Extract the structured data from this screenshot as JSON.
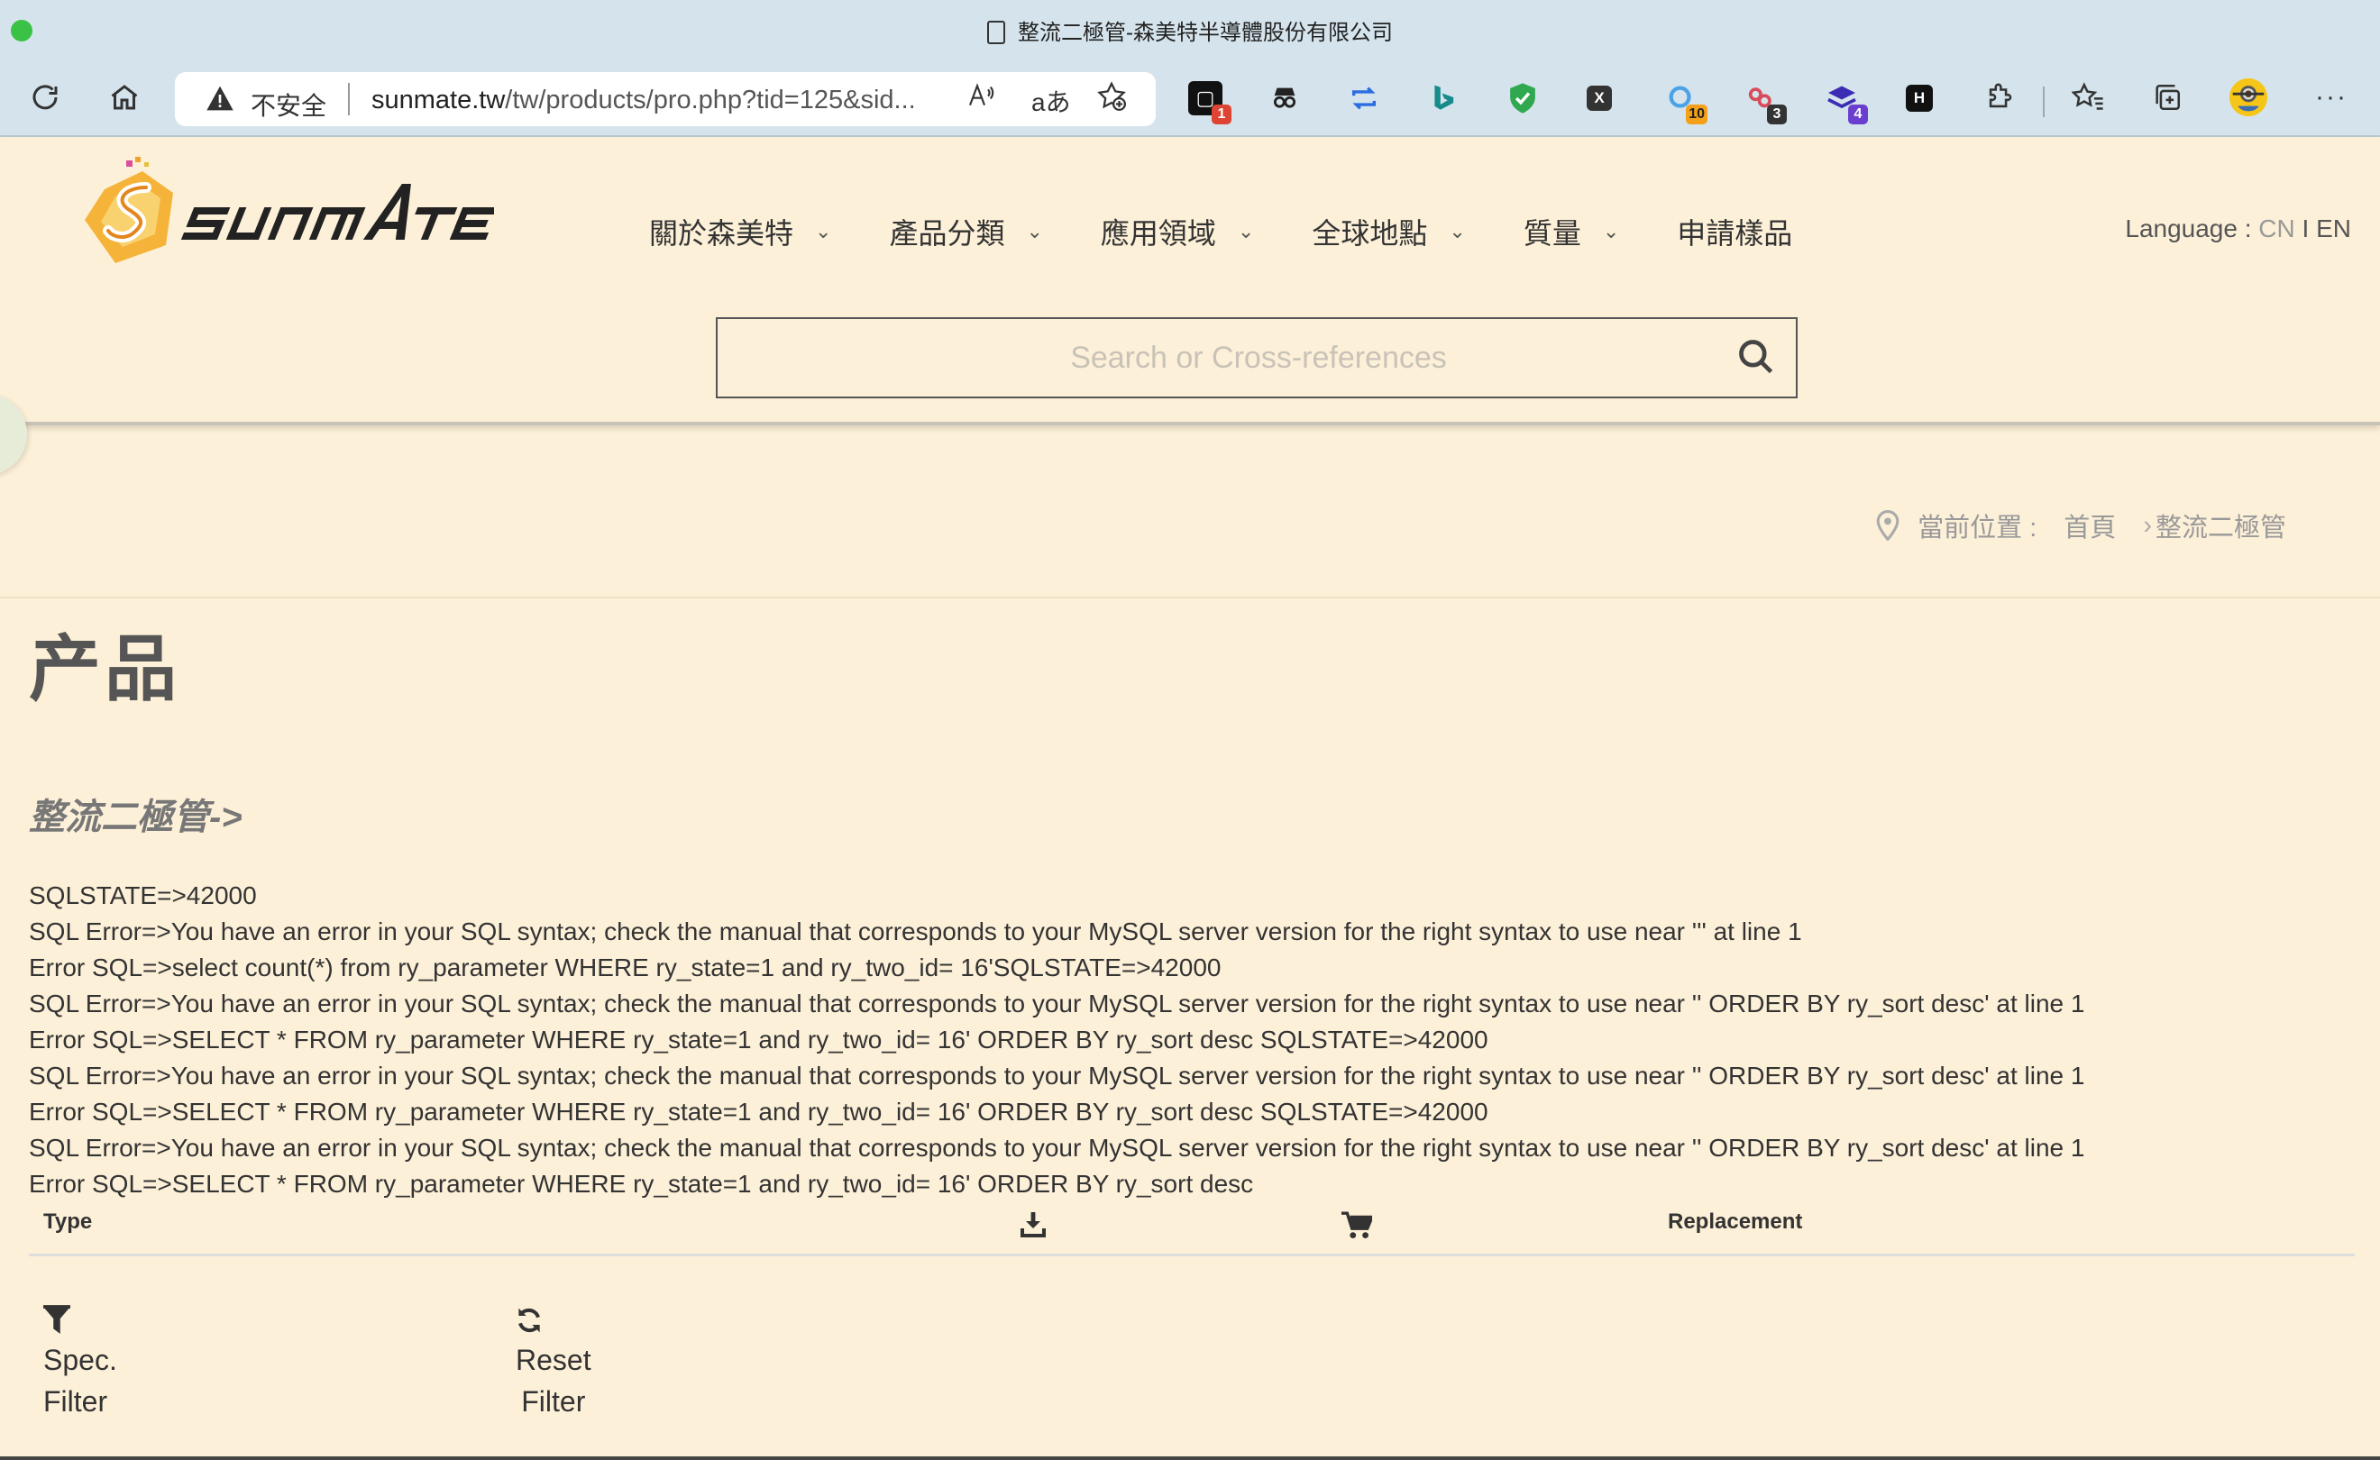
{
  "browser": {
    "tab_title": "整流二極管-森美特半導體股份有限公司",
    "security_label": "不安全",
    "url_host": "sunmate.tw",
    "url_path": "/tw/products/pro.php?tid=125&sid...",
    "extension_badges": {
      "ext1": "1",
      "ext7": "10",
      "ext8": "3",
      "ext9": "4"
    },
    "ext_letters": {
      "x": "X",
      "h": "H"
    }
  },
  "site": {
    "nav": [
      {
        "label": "關於森美特",
        "has_dropdown": true
      },
      {
        "label": "產品分類",
        "has_dropdown": true
      },
      {
        "label": "應用領域",
        "has_dropdown": true
      },
      {
        "label": "全球地點",
        "has_dropdown": true
      },
      {
        "label": "質量",
        "has_dropdown": true
      },
      {
        "label": "申請樣品",
        "has_dropdown": false
      }
    ],
    "language_label": "Language :",
    "lang_cn": "CN",
    "lang_sep": "I",
    "lang_en": "EN",
    "search_placeholder": "Search or Cross-references"
  },
  "breadcrumb": {
    "prefix": "當前位置 :",
    "home": "首頁",
    "current": "整流二極管"
  },
  "content": {
    "page_title": "产品",
    "category": "整流二極管->",
    "error_lines": [
      "SQLSTATE=>42000",
      "SQL Error=>You have an error in your SQL syntax; check the manual that corresponds to your MySQL server version for the right syntax to use near ''' at line 1",
      "Error SQL=>select count(*) from ry_parameter WHERE ry_state=1 and ry_two_id= 16'SQLSTATE=>42000",
      "SQL Error=>You have an error in your SQL syntax; check the manual that corresponds to your MySQL server version for the right syntax to use near '' ORDER BY ry_sort desc' at line 1",
      "Error SQL=>SELECT * FROM ry_parameter WHERE ry_state=1 and ry_two_id= 16' ORDER BY ry_sort desc SQLSTATE=>42000",
      "SQL Error=>You have an error in your SQL syntax; check the manual that corresponds to your MySQL server version for the right syntax to use near '' ORDER BY ry_sort desc' at line 1",
      "Error SQL=>SELECT * FROM ry_parameter WHERE ry_state=1 and ry_two_id= 16' ORDER BY ry_sort desc SQLSTATE=>42000",
      "SQL Error=>You have an error in your SQL syntax; check the manual that corresponds to your MySQL server version for the right syntax to use near '' ORDER BY ry_sort desc' at line 1",
      "Error SQL=>SELECT * FROM ry_parameter WHERE ry_state=1 and ry_two_id= 16' ORDER BY ry_sort desc"
    ],
    "table_headers": {
      "type": "Type",
      "replacement": "Replacement"
    },
    "filters": {
      "spec_line1": "Spec.",
      "spec_line2": "Filter",
      "reset_line1": "Reset",
      "reset_line2": "Filter"
    }
  },
  "colors": {
    "page_bg": "#fdf0d8",
    "chrome_bg": "#d5e4ec",
    "text": "#333333"
  }
}
